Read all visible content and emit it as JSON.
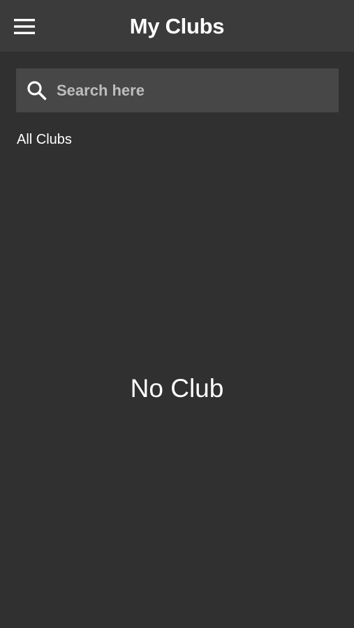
{
  "header": {
    "title": "My Clubs",
    "menu_icon": "hamburger-menu-icon",
    "background": "#3b3b3b"
  },
  "search": {
    "icon": "search-icon",
    "placeholder": "Search here",
    "value": ""
  },
  "section": {
    "label": "All Clubs"
  },
  "empty_state": {
    "message": "No Club"
  },
  "colors": {
    "background": "#303030",
    "search_field": "#474747",
    "text": "#ffffff",
    "placeholder": "#bdbdbd"
  }
}
